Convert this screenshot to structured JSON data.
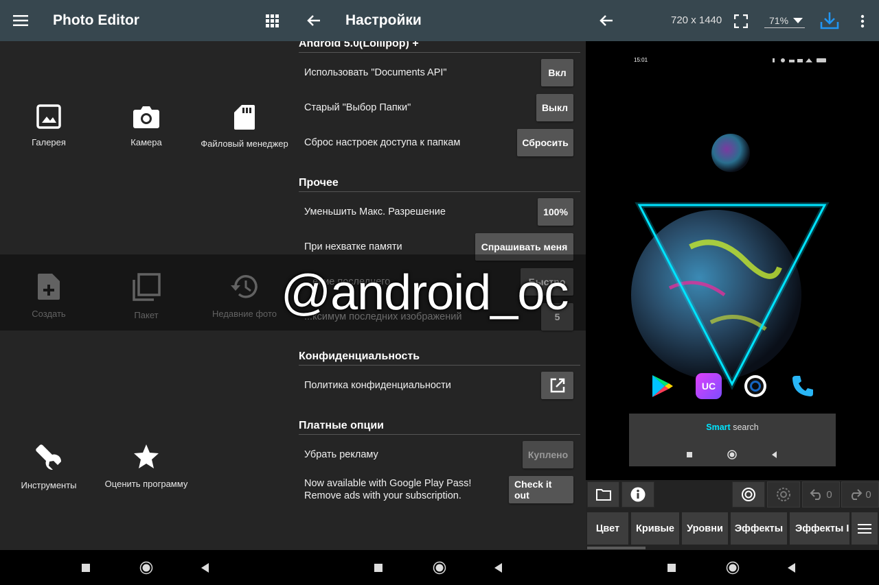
{
  "panel1": {
    "title": "Photo Editor",
    "tiles": [
      {
        "label": "Галерея",
        "icon": "image-icon"
      },
      {
        "label": "Камера",
        "icon": "camera-icon"
      },
      {
        "label": "Файловый менеджер",
        "icon": "sd-card-icon"
      },
      {
        "label": "Создать",
        "icon": "new-file-icon"
      },
      {
        "label": "Пакет",
        "icon": "batch-icon"
      },
      {
        "label": "Недавние фото",
        "icon": "history-icon"
      },
      {
        "label": "Инструменты",
        "icon": "wrench-icon"
      },
      {
        "label": "Оценить программу",
        "icon": "star-icon"
      }
    ]
  },
  "panel2": {
    "title": "Настройки",
    "sections": {
      "android": "Android 5.0(Lollipop) +",
      "other": "Прочее",
      "privacy": "Конфиденциальность",
      "paid": "Платные опции"
    },
    "rows": {
      "documents_api": {
        "label": "Использовать \"Documents API\"",
        "button": "Вкл"
      },
      "old_picker": {
        "label": "Старый \"Выбор Папки\"",
        "button": "Выкл"
      },
      "reset_access": {
        "label": "Сброс настроек доступа к папкам",
        "button": "Сбросить"
      },
      "max_res": {
        "label": "Уменьшить Макс. Разрешение",
        "button": "100%"
      },
      "low_memory": {
        "label": "При нехватке памяти",
        "button": "Спрашивать меня"
      },
      "hidden_1": {
        "label": "...ение последнего...",
        "button": "Быстро"
      },
      "hidden_2": {
        "label": "...ксимум последних изображений",
        "button": "5"
      },
      "privacy_policy": {
        "label": "Политика конфиденциальности"
      },
      "remove_ads": {
        "label": "Убрать рекламу",
        "button": "Куплено"
      },
      "play_pass_1": {
        "label": "Now available with Google Play Pass!"
      },
      "play_pass_2": {
        "label": "Remove ads with your subscription."
      },
      "play_pass_button": "Check it out"
    }
  },
  "panel3": {
    "resolution": "720 x 1440",
    "zoom": "71%",
    "phone_time": "15:01",
    "smart_search_1": "Smart",
    "smart_search_2": " search",
    "undo_count": "0",
    "redo_count": "0",
    "tabs": [
      "Цвет",
      "Кривые",
      "Уровни",
      "Эффекты",
      "Эффекты II"
    ],
    "colors": {
      "accent": "#2196f3",
      "cyan": "#00e5ff"
    }
  },
  "watermark": "@android_oc"
}
